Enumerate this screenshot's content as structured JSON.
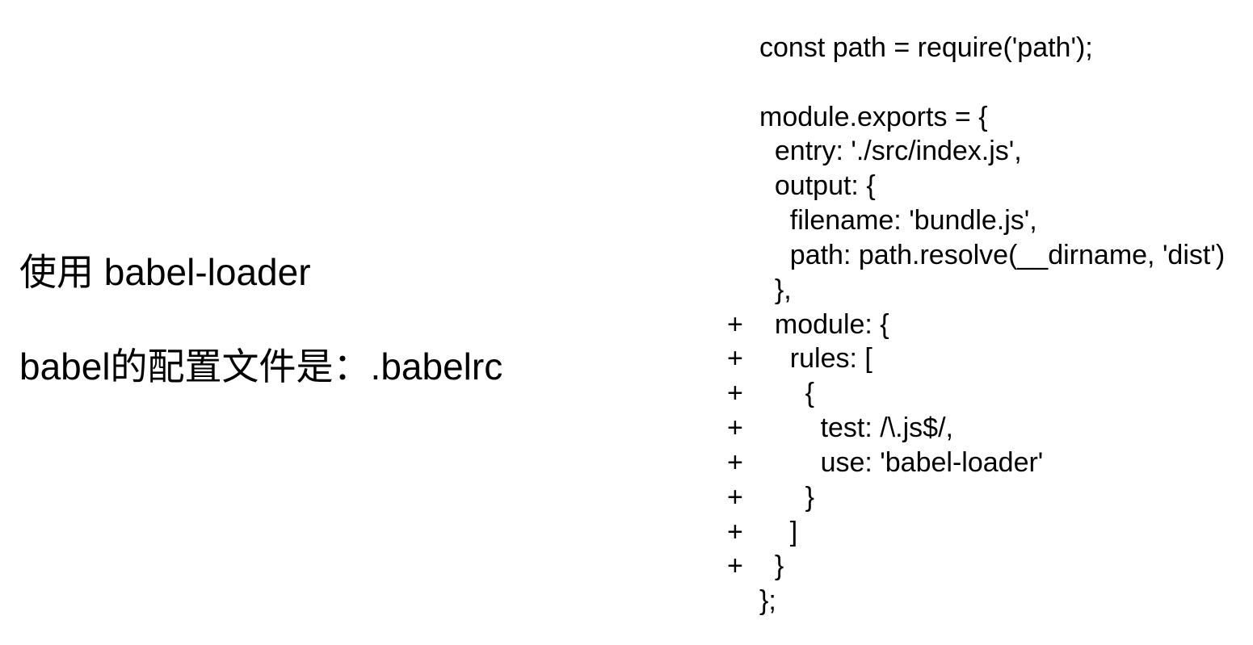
{
  "left": {
    "heading1": "使用 babel-loader",
    "heading2": "babel的配置文件是：.babelrc"
  },
  "code": {
    "lines": [
      {
        "prefix": "",
        "text": "const path = require('path');"
      },
      {
        "prefix": "",
        "text": ""
      },
      {
        "prefix": "",
        "text": "module.exports = {"
      },
      {
        "prefix": "",
        "text": "  entry: './src/index.js',"
      },
      {
        "prefix": "",
        "text": "  output: {"
      },
      {
        "prefix": "",
        "text": "    filename: 'bundle.js',"
      },
      {
        "prefix": "",
        "text": "    path: path.resolve(__dirname, 'dist')"
      },
      {
        "prefix": "",
        "text": "  },"
      },
      {
        "prefix": "+",
        "text": "  module: {"
      },
      {
        "prefix": "+",
        "text": "    rules: ["
      },
      {
        "prefix": "+",
        "text": "      {"
      },
      {
        "prefix": "+",
        "text": "        test: /\\.js$/,"
      },
      {
        "prefix": "+",
        "text": "        use: 'babel-loader'"
      },
      {
        "prefix": "+",
        "text": "      }"
      },
      {
        "prefix": "+",
        "text": "    ]"
      },
      {
        "prefix": "+",
        "text": "  }"
      },
      {
        "prefix": "",
        "text": "};"
      }
    ]
  }
}
